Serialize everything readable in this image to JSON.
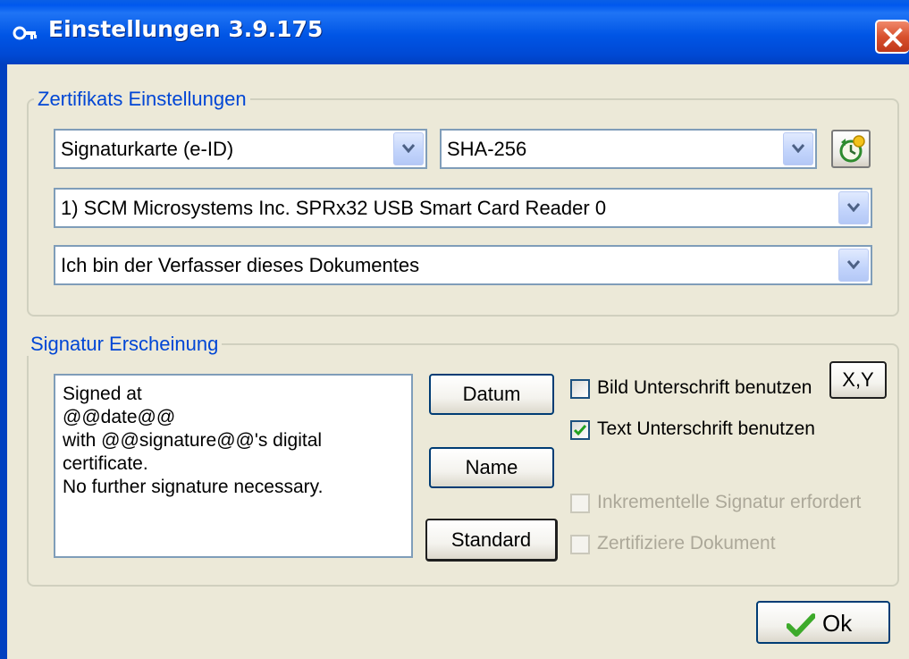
{
  "window": {
    "title": "Einstellungen 3.9.175"
  },
  "certificate_group": {
    "legend": "Zertifikats Einstellungen",
    "card_type": "Signaturkarte (e-ID)",
    "hash_algorithm": "SHA-256",
    "reader": "1) SCM Microsystems Inc. SPRx32 USB Smart Card Reader 0",
    "reason": "Ich bin der Verfasser dieses Dokumentes"
  },
  "appearance_group": {
    "legend": "Signatur Erscheinung",
    "signature_text": "Signed at\n@@date@@\nwith @@signature@@'s digital\ncertificate.\nNo further signature necessary.",
    "buttons": {
      "date": "Datum",
      "name": "Name",
      "standard": "Standard",
      "xy": "X,Y"
    },
    "options": {
      "image_signature": {
        "label": "Bild Unterschrift benutzen",
        "checked": false
      },
      "text_signature": {
        "label": "Text Unterschrift benutzen",
        "checked": true
      },
      "incremental": {
        "label": "Inkrementelle Signatur erfordert",
        "checked": false,
        "enabled": false
      },
      "certify": {
        "label": "Zertifiziere Dokument",
        "checked": false,
        "enabled": false
      }
    }
  },
  "footer": {
    "ok_label": "Ok"
  },
  "colors": {
    "titlebar": "#0055E5",
    "legend_text": "#0046D5",
    "check_green": "#21A121",
    "close_red": "#D8512E"
  }
}
